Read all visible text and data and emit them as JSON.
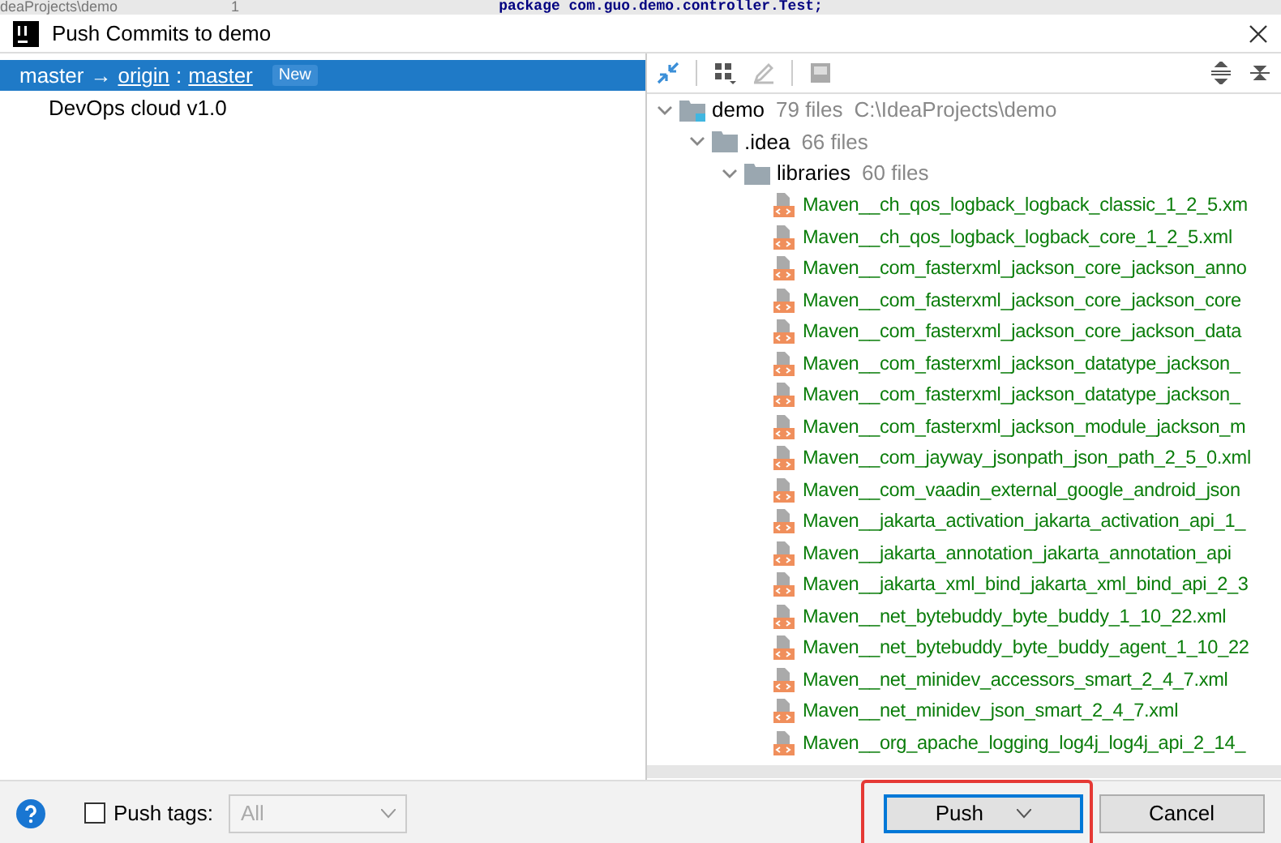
{
  "background_editor": {
    "path": "deaProjects\\demo",
    "line_number": "1",
    "code": "package com.guo.demo.controller.Test;"
  },
  "window": {
    "title": "Push Commits to demo"
  },
  "branches": [
    {
      "source": "master",
      "arrow": "→",
      "remote": "origin",
      "separator": ":",
      "target": "master",
      "badge": "New",
      "selected": true,
      "commits": [
        "DevOps cloud v1.0"
      ]
    }
  ],
  "tree": [
    {
      "kind": "module",
      "name": "demo",
      "info": "79 files",
      "path": "C:\\IdeaProjects\\demo",
      "expanded": true,
      "children": [
        {
          "kind": "folder",
          "name": ".idea",
          "info": "66 files",
          "expanded": true,
          "children": [
            {
              "kind": "folder",
              "name": "libraries",
              "info": "60 files",
              "expanded": true,
              "children": [
                {
                  "kind": "file",
                  "name": "Maven__ch_qos_logback_logback_classic_1_2_5.xm"
                },
                {
                  "kind": "file",
                  "name": "Maven__ch_qos_logback_logback_core_1_2_5.xml"
                },
                {
                  "kind": "file",
                  "name": "Maven__com_fasterxml_jackson_core_jackson_anno"
                },
                {
                  "kind": "file",
                  "name": "Maven__com_fasterxml_jackson_core_jackson_core"
                },
                {
                  "kind": "file",
                  "name": "Maven__com_fasterxml_jackson_core_jackson_data"
                },
                {
                  "kind": "file",
                  "name": "Maven__com_fasterxml_jackson_datatype_jackson_"
                },
                {
                  "kind": "file",
                  "name": "Maven__com_fasterxml_jackson_datatype_jackson_"
                },
                {
                  "kind": "file",
                  "name": "Maven__com_fasterxml_jackson_module_jackson_m"
                },
                {
                  "kind": "file",
                  "name": "Maven__com_jayway_jsonpath_json_path_2_5_0.xml"
                },
                {
                  "kind": "file",
                  "name": "Maven__com_vaadin_external_google_android_json"
                },
                {
                  "kind": "file",
                  "name": "Maven__jakarta_activation_jakarta_activation_api_1_"
                },
                {
                  "kind": "file",
                  "name": "Maven__jakarta_annotation_jakarta_annotation_api"
                },
                {
                  "kind": "file",
                  "name": "Maven__jakarta_xml_bind_jakarta_xml_bind_api_2_3"
                },
                {
                  "kind": "file",
                  "name": "Maven__net_bytebuddy_byte_buddy_1_10_22.xml"
                },
                {
                  "kind": "file",
                  "name": "Maven__net_bytebuddy_byte_buddy_agent_1_10_22"
                },
                {
                  "kind": "file",
                  "name": "Maven__net_minidev_accessors_smart_2_4_7.xml"
                },
                {
                  "kind": "file",
                  "name": "Maven__net_minidev_json_smart_2_4_7.xml"
                },
                {
                  "kind": "file",
                  "name": "Maven__org_apache_logging_log4j_log4j_api_2_14_"
                }
              ]
            }
          ]
        }
      ]
    }
  ],
  "push_tags": {
    "label": "Push tags:",
    "checked": false,
    "dropdown": {
      "value": "All",
      "disabled": true
    }
  },
  "buttons": [
    {
      "kind": "split",
      "label": "Push",
      "focused": true,
      "highlighted": true
    },
    {
      "kind": "plain",
      "label": "Cancel",
      "focused": false,
      "highlighted": false
    }
  ]
}
